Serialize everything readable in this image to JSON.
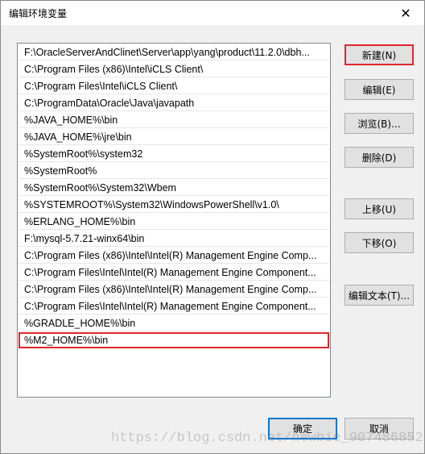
{
  "window": {
    "title": "编辑环境变量",
    "close_glyph": "✕"
  },
  "path_list": [
    "F:\\OracleServerAndClinet\\Server\\app\\yang\\product\\11.2.0\\dbh...",
    "C:\\Program Files (x86)\\Intel\\iCLS Client\\",
    "C:\\Program Files\\Intel\\iCLS Client\\",
    "C:\\ProgramData\\Oracle\\Java\\javapath",
    "%JAVA_HOME%\\bin",
    "%JAVA_HOME%\\jre\\bin",
    "%SystemRoot%\\system32",
    "%SystemRoot%",
    "%SystemRoot%\\System32\\Wbem",
    "%SYSTEMROOT%\\System32\\WindowsPowerShell\\v1.0\\",
    "%ERLANG_HOME%\\bin",
    "F:\\mysql-5.7.21-winx64\\bin",
    "C:\\Program Files (x86)\\Intel\\Intel(R) Management Engine Comp...",
    "C:\\Program Files\\Intel\\Intel(R) Management Engine Component...",
    "C:\\Program Files (x86)\\Intel\\Intel(R) Management Engine Comp...",
    "C:\\Program Files\\Intel\\Intel(R) Management Engine Component...",
    "%GRADLE_HOME%\\bin",
    "%M2_HOME%\\bin"
  ],
  "buttons": {
    "new": "新建(N)",
    "edit": "编辑(E)",
    "browse": "浏览(B)...",
    "delete": "删除(D)",
    "move_up": "上移(U)",
    "move_down": "下移(O)",
    "edit_text": "编辑文本(T)...",
    "ok": "确定",
    "cancel": "取消"
  },
  "watermark": "https://blog.csdn.net/newbie_907486852",
  "colors": {
    "highlight_red": "#e0262a",
    "focus_blue": "#0078d7"
  }
}
